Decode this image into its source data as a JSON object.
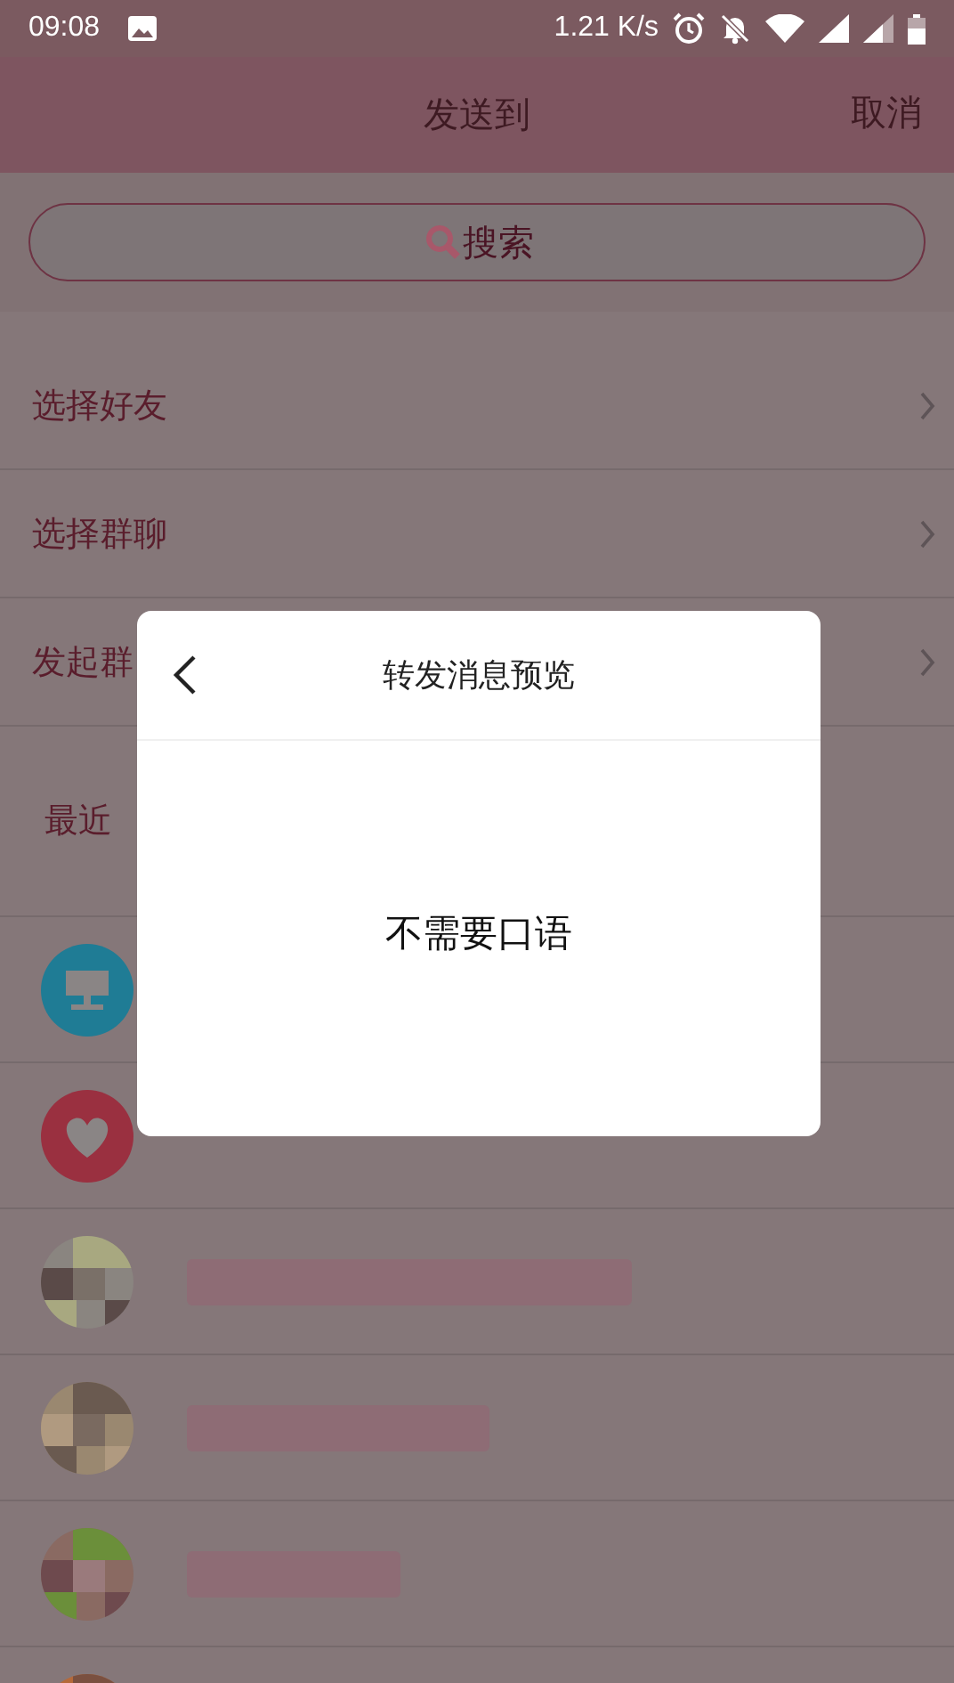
{
  "status_bar": {
    "time": "09:08",
    "speed": "1.21 K/s"
  },
  "header": {
    "title": "发送到",
    "action": "取消"
  },
  "search": {
    "placeholder": "搜索"
  },
  "menu": [
    {
      "label": "选择好友"
    },
    {
      "label": "选择群聊"
    },
    {
      "label": "发起群"
    }
  ],
  "section": {
    "title": "最近"
  },
  "contacts": [
    {
      "kind": "device"
    },
    {
      "kind": "favorite"
    },
    {
      "kind": "picture"
    },
    {
      "kind": "picture"
    },
    {
      "kind": "picture"
    },
    {
      "kind": "picture"
    }
  ],
  "dialog": {
    "title": "转发消息预览",
    "message": "不需要口语"
  }
}
